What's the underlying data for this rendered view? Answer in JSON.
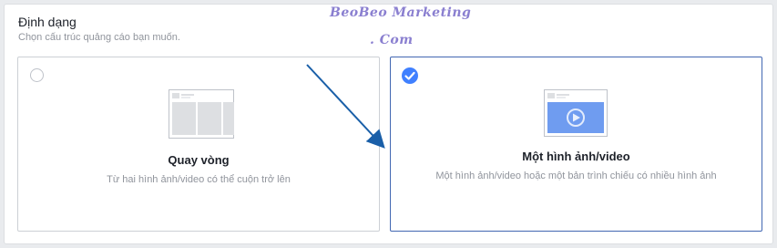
{
  "section": {
    "title": "Định dạng",
    "subtitle": "Chọn cấu trúc quảng cáo bạn muốn."
  },
  "watermark": {
    "line1": "BeoBeo Marketing",
    "line2": ". Com"
  },
  "formats": [
    {
      "title": "Quay vòng",
      "description": "Từ hai hình ảnh/video có thể cuộn trở lên",
      "selected": false,
      "icon": "carousel-preview-icon"
    },
    {
      "title": "Một hình ảnh/video",
      "description": "Một hình ảnh/video hoặc một bản trình chiếu có nhiều hình ảnh",
      "selected": true,
      "icon": "single-image-video-preview-icon"
    }
  ],
  "colors": {
    "accent": "#4080ff",
    "selected_border": "#4267b2",
    "arrow": "#1a5fa8"
  }
}
